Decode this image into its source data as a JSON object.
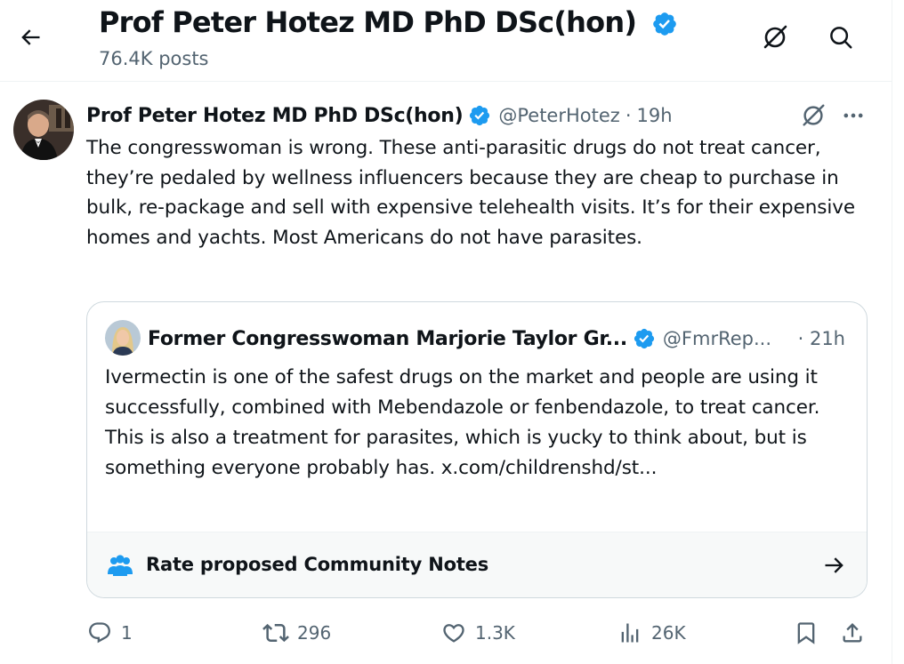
{
  "header": {
    "title": "Prof Peter Hotez MD PhD DSc(hon)",
    "post_count": "76.4K posts"
  },
  "tweet": {
    "author_name": "Prof Peter Hotez MD PhD DSc(hon)",
    "handle": "@PeterHotez",
    "separator": "·",
    "time": "19h",
    "text": "The congresswoman is wrong. These anti-parasitic drugs do not treat cancer, they’re pedaled by wellness influencers because they are cheap to purchase in bulk, re-package and sell with expensive telehealth visits. It’s for their expensive homes and yachts. Most Americans do not have parasites."
  },
  "quote": {
    "author_name": "Former Congresswoman Marjorie Taylor Gr...",
    "handle": "@FmrRep...",
    "time": "· 21h",
    "text_line1": "Ivermectin is one of the safest drugs on the market and people are using it successfully, combined with Mebendazole or fenbendazole, to treat cancer.",
    "text_line2": "This is also a treatment for parasites, which is yucky to think about, but is something everyone probably has. x.com/childrenshd/st...",
    "community_notes_label": "Rate proposed Community Notes"
  },
  "actions": {
    "replies": "1",
    "reposts": "296",
    "likes": "1.3K",
    "views": "26K"
  },
  "icons": {
    "back": "arrow-left-icon",
    "grok": "grok-icon",
    "search": "search-icon",
    "more": "more-horizontal-icon",
    "verified": "verified-badge-icon",
    "notes": "community-notes-icon",
    "arrow_right": "arrow-right-icon",
    "reply": "reply-icon",
    "repost": "repost-icon",
    "like": "heart-icon",
    "views": "views-icon",
    "bookmark": "bookmark-icon",
    "share": "share-icon"
  },
  "colors": {
    "verified": "#1d9bf0",
    "text": "#0f1419",
    "secondary": "#536471",
    "notes_bg": "#f7f9f9",
    "notes_icon": "#1d9bf0"
  }
}
